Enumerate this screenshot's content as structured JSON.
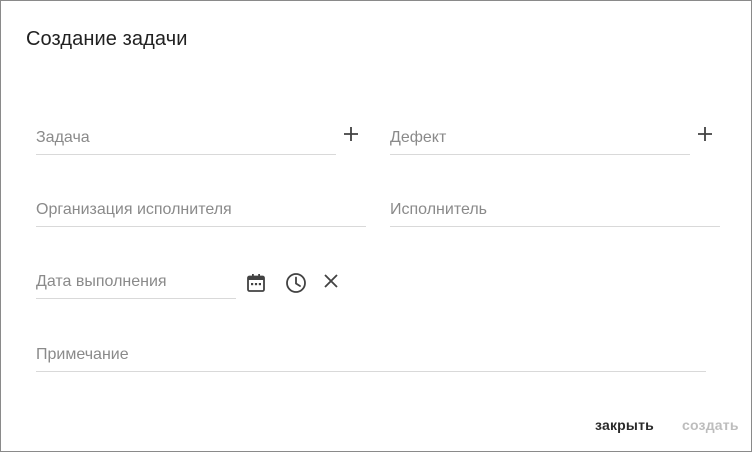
{
  "dialog": {
    "title": "Создание задачи"
  },
  "form": {
    "task_label": "Задача",
    "defect_label": "Дефект",
    "org_label": "Организация исполнителя",
    "executor_label": "Исполнитель",
    "due_date_label": "Дата выполнения",
    "note_label": "Примечание"
  },
  "actions": {
    "close_label": "закрыть",
    "create_label": "создать"
  },
  "icons": {
    "task_add": "plus-icon",
    "defect_add": "plus-icon",
    "calendar": "calendar-icon",
    "clock": "clock-icon",
    "clear": "close-icon"
  },
  "colors": {
    "text": "#212121",
    "label": "#8a8a8a",
    "underline": "#d9d9d9",
    "disabled": "#bdbdbd"
  }
}
